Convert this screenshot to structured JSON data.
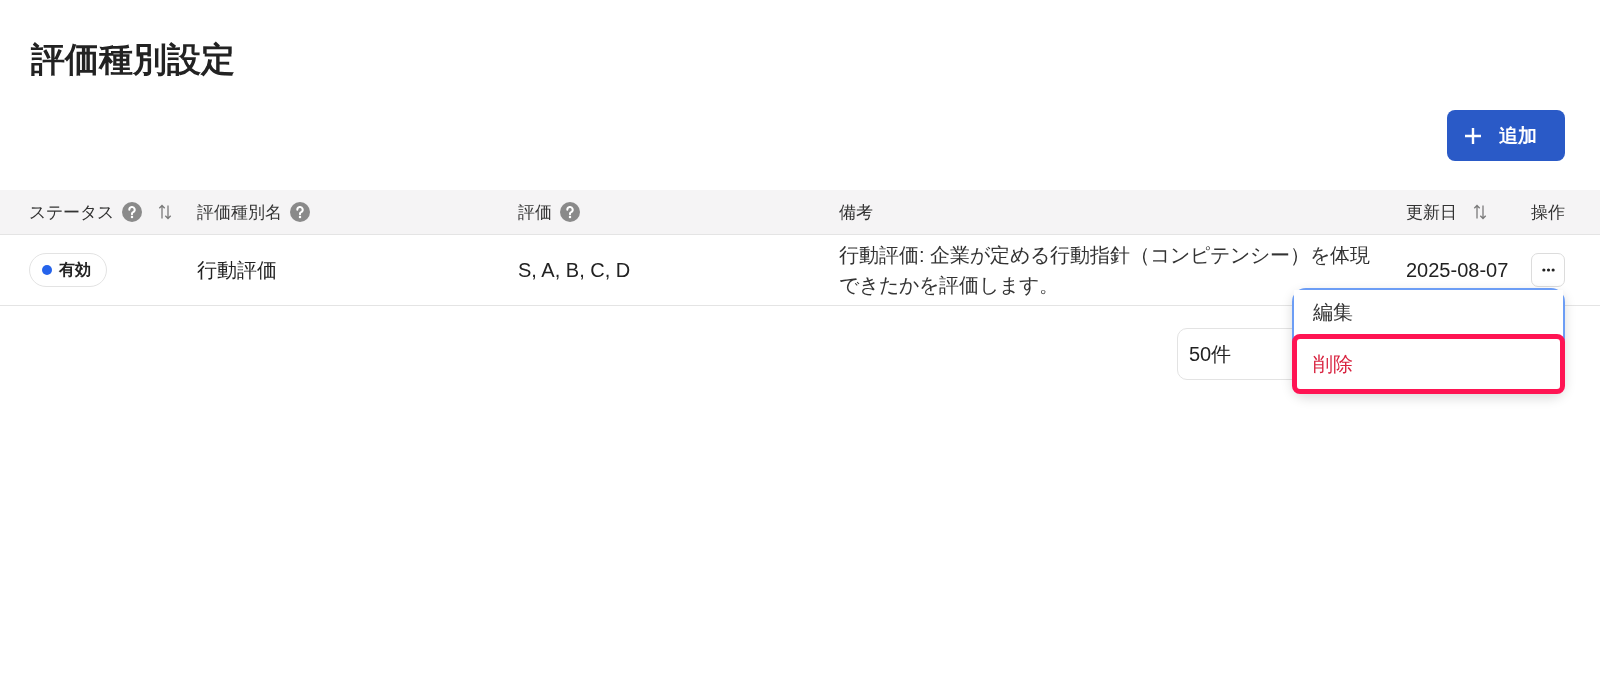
{
  "page": {
    "title": "評価種別設定"
  },
  "toolbar": {
    "add_button": {
      "label": "追加"
    }
  },
  "table": {
    "columns": [
      {
        "label": "ステータス",
        "help": true,
        "sortable": true
      },
      {
        "label": "評価種別名",
        "help": true,
        "sortable": false
      },
      {
        "label": "評価",
        "help": true,
        "sortable": false
      },
      {
        "label": "備考",
        "help": false,
        "sortable": false
      },
      {
        "label": "更新日",
        "help": false,
        "sortable": true
      },
      {
        "label": "操作",
        "help": false,
        "sortable": false
      }
    ],
    "rows": [
      {
        "status": {
          "label": "有効",
          "color": "#2563eb"
        },
        "name": "行動評価",
        "grades": "S, A, B, C, D",
        "remark": "行動評価: 企業が定める行動指針（コンピテンシー）を体現できたかを評価します。",
        "updated": "2025-08-07",
        "action_menu": {
          "open": true,
          "focused": true,
          "items": [
            {
              "label": "編集",
              "kind": "default",
              "selected": false
            },
            {
              "label": "削除",
              "kind": "danger",
              "selected": true
            }
          ]
        }
      }
    ]
  },
  "pagination": {
    "page_size": "50件"
  }
}
